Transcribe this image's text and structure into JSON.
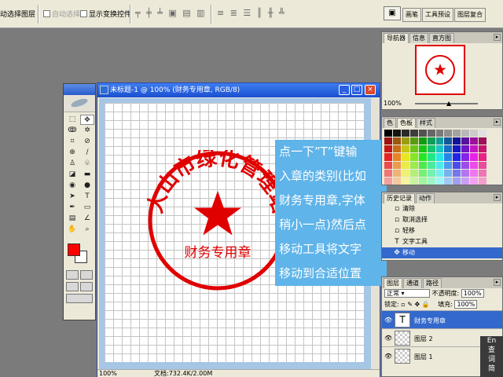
{
  "options_bar": {
    "auto_select_layer": "动选择图层",
    "auto_select_group": "自动选择组",
    "show_transform": "显示变换控件"
  },
  "well_tabs": [
    "画笔",
    "工具预设",
    "图层复合"
  ],
  "document": {
    "title": "未标题-1 @ 100% (财务专用章, RGB/8)",
    "zoom": "100%",
    "doc_size": "文档:732.4K/2.00M",
    "stamp_arc_text": "大山市绿化管理站",
    "stamp_bottom_text": "财务专用章",
    "stamp_color": "#e00000"
  },
  "annotation": {
    "lines": [
      "点一下”T”键输",
      "入章的类别(比如",
      "财务专用章,字体",
      "稍小一点)然后点",
      "移动工具将文字",
      "移动到合适位置"
    ],
    "bg": "#5fb4e9"
  },
  "navigator": {
    "tabs": [
      "导航器",
      "信息",
      "直方图"
    ],
    "zoom": "100%"
  },
  "color_panel": {
    "tabs": [
      "色",
      "色板",
      "样式"
    ]
  },
  "history": {
    "tabs": [
      "历史记录",
      "动作"
    ],
    "items": [
      {
        "label": "清除",
        "icon": "history-step-icon"
      },
      {
        "label": "取消选择",
        "icon": "history-step-icon"
      },
      {
        "label": "轻移",
        "icon": "history-step-icon"
      },
      {
        "label": "文字工具",
        "icon": "type-tool-icon"
      },
      {
        "label": "移动",
        "icon": "move-tool-icon"
      }
    ]
  },
  "layers": {
    "tabs": [
      "图层",
      "通道",
      "路径"
    ],
    "blend_mode": "正常",
    "opacity_label": "不透明度:",
    "opacity": "100%",
    "lock_label": "锁定:",
    "fill_label": "填充:",
    "fill": "100%",
    "items": [
      {
        "name": "财务专用章",
        "type": "text",
        "thumb_label": "T"
      },
      {
        "name": "图层 2",
        "type": "pixel"
      },
      {
        "name": "图层 1",
        "type": "pixel"
      }
    ]
  },
  "side_box": [
    "En",
    "查",
    "词",
    "简",
    "繁"
  ],
  "colors": {
    "foreground": "#ff0000",
    "background": "#ffffff",
    "accent": "#3368cc"
  }
}
